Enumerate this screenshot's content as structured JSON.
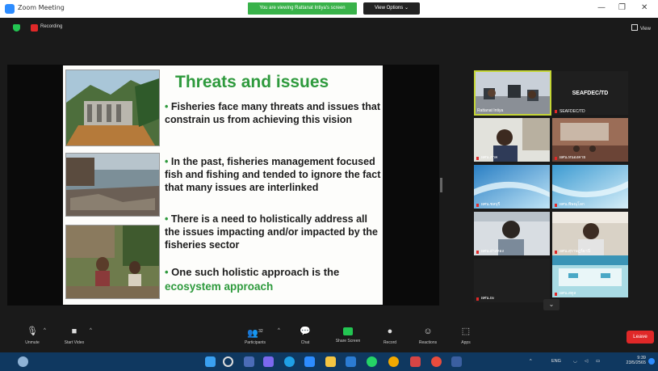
{
  "window": {
    "title": "Zoom Meeting",
    "share_banner": "You are viewing Rattanat Intiya's screen",
    "view_options": "View Options ⌄",
    "minimize": "—",
    "restore": "❐",
    "close": "✕"
  },
  "status": {
    "recording": "Recording",
    "view": "View"
  },
  "slide": {
    "title": "Threats and issues",
    "bullets": [
      "Fisheries face many threats and issues that constrain us from achieving this vision",
      "In the past, fisheries management focused fish and fishing and tended to ignore the fact that many issues are interlinked",
      "There is a need to holistically address all the issues impacting and/or impacted by the fisheries sector"
    ],
    "last_bullet_prefix": "One such holistic approach is the",
    "last_bullet_highlight": "ecosystem approach"
  },
  "participants": [
    {
      "name": "Rattanat Intiya"
    },
    {
      "name": "SEAFDEC/TD",
      "label": "SEAFDEC/TD"
    },
    {
      "name": "ผศน.ภาค"
    },
    {
      "name": "ผศน.หนองคาย"
    },
    {
      "name": "ผศน.ชลบุรี"
    },
    {
      "name": "ผศน.พิษณุโลก"
    },
    {
      "name": "ผศน.อ่างทอง"
    },
    {
      "name": "ผศน.สุราษฎร์ธานี"
    },
    {
      "name": "ผศน.ยะ"
    },
    {
      "name": "ผศน.สตูล"
    }
  ],
  "toolbar": {
    "unmute": "Unmute",
    "start_video": "Start Video",
    "participants": "Participants",
    "participants_count": "32",
    "chat": "Chat",
    "share_screen": "Share Screen",
    "record": "Record",
    "reactions": "Reactions",
    "apps": "Apps",
    "leave": "Leave"
  },
  "taskbar": {
    "lang": "ENG",
    "time": "9:39",
    "date": "23/5/2565"
  },
  "colors": {
    "accent_green": "#2e9a3d",
    "leave_red": "#e02828",
    "zoom_blue": "#2d8cff"
  }
}
